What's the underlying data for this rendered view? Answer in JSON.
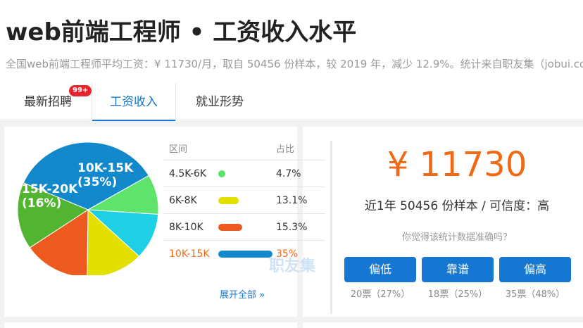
{
  "header": {
    "title": "web前端工程师 • 工资收入水平",
    "subtitle": "全国web前端工程师平均工资：¥ 11730/月，取自 50456 份样本，较 2019 年，减少 12.9%。统计来自职友集（jobui.com）"
  },
  "tabs": [
    {
      "label": "最新招聘",
      "badge": "99+"
    },
    {
      "label": "工资收入",
      "active": true
    },
    {
      "label": "就业形势"
    }
  ],
  "legend": {
    "col_range": "区间",
    "col_share": "占比",
    "expand": "展开全部 »"
  },
  "chart_data": {
    "type": "pie",
    "title": "",
    "slices": [
      {
        "label": "10K-15K",
        "value": 35,
        "color": "#1389cc"
      },
      {
        "label": "",
        "value": 9.5,
        "color": "#5ee36b"
      },
      {
        "label": "",
        "value": 11,
        "color": "#1fcfe3"
      },
      {
        "label": "",
        "value": 13.1,
        "color": "#e3e000"
      },
      {
        "label": "",
        "value": 15.3,
        "color": "#ec5a1f"
      },
      {
        "label": "15K-20K",
        "value": 16,
        "color": "#52b531"
      }
    ],
    "slice_labels": [
      {
        "name": "10K-15K",
        "pct": "(35%)"
      },
      {
        "name": "15K-20K",
        "pct": "(16%)"
      }
    ],
    "legend_rows": [
      {
        "range": "4.5K-6K",
        "share": "4.7%",
        "pct": 4.7,
        "color": "#5ee36b"
      },
      {
        "range": "6K-8K",
        "share": "13.1%",
        "pct": 13.1,
        "color": "#e3e000"
      },
      {
        "range": "8K-10K",
        "share": "15.3%",
        "pct": 15.3,
        "color": "#ec5a1f"
      },
      {
        "range": "10K-15K",
        "share": "35%",
        "pct": 35,
        "color": "#1389cc"
      }
    ]
  },
  "salary": {
    "amount": "¥ 11730",
    "sample_text": "近1年 50456 份样本 / 可信度：高",
    "question": "你觉得该统计数据准确吗？"
  },
  "votes": [
    {
      "label": "偏低",
      "count": "20票（27%）"
    },
    {
      "label": "靠谱",
      "count": "18票（25%）"
    },
    {
      "label": "偏高",
      "count": "35票（48%）"
    }
  ],
  "watermark": "职友集",
  "colors": {
    "accent": "#1677d2",
    "highlight": "#f06a16",
    "badge": "#e8232d"
  }
}
